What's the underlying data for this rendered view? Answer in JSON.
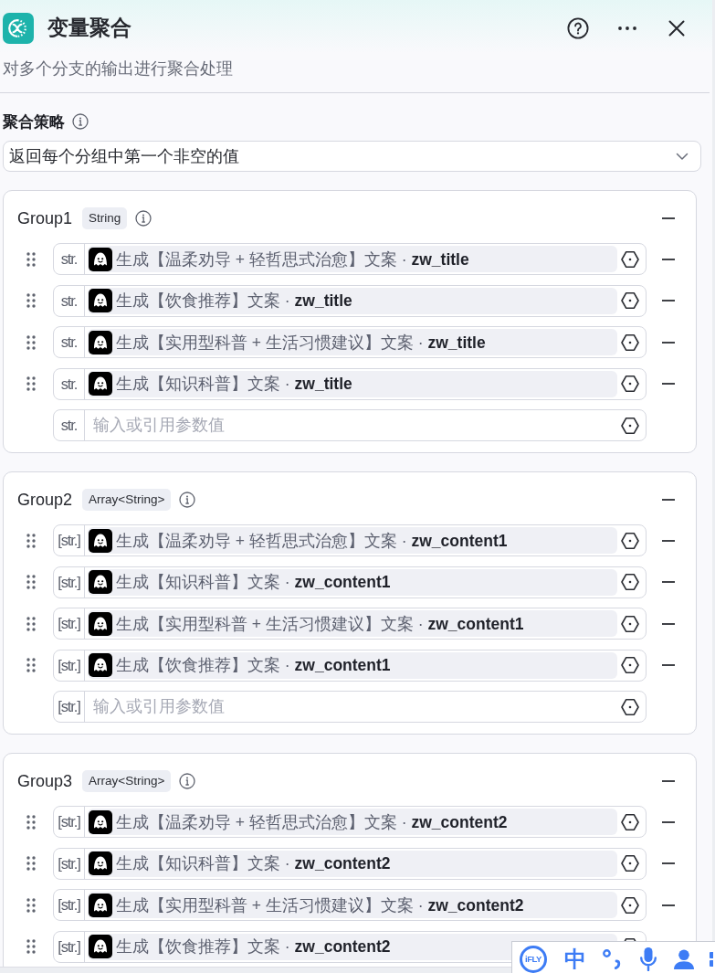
{
  "header": {
    "title": "变量聚合",
    "subtitle": "对多个分支的输出进行聚合处理"
  },
  "strategy": {
    "label": "聚合策略",
    "value": "返回每个分组中第一个非空的值"
  },
  "groups": [
    {
      "title": "Group1",
      "type": "String",
      "rows": [
        {
          "kind": "reference",
          "type_label": "str.",
          "text": "生成【温柔劝导 + 轻哲思式治愈】文案 · **zw_title**"
        },
        {
          "kind": "reference",
          "type_label": "str.",
          "text": "生成【饮食推荐】文案 · **zw_title**"
        },
        {
          "kind": "reference",
          "type_label": "str.",
          "text": "生成【实用型科普 + 生活习惯建议】文案 · **zw_title**"
        },
        {
          "kind": "reference",
          "type_label": "str.",
          "text": "生成【知识科普】文案 · **zw_title**"
        },
        {
          "kind": "input",
          "type_label": "str.",
          "placeholder": "输入或引用参数值"
        }
      ]
    },
    {
      "title": "Group2",
      "type": "Array<String>",
      "rows": [
        {
          "kind": "reference",
          "type_label": "[str.]",
          "text": "生成【温柔劝导 + 轻哲思式治愈】文案 · **zw_content1**"
        },
        {
          "kind": "reference",
          "type_label": "[str.]",
          "text": "生成【知识科普】文案 · **zw_content1**"
        },
        {
          "kind": "reference",
          "type_label": "[str.]",
          "text": "生成【实用型科普 + 生活习惯建议】文案 · **zw_content1**"
        },
        {
          "kind": "reference",
          "type_label": "[str.]",
          "text": "生成【饮食推荐】文案 · **zw_content1**"
        },
        {
          "kind": "input",
          "type_label": "[str.]",
          "placeholder": "输入或引用参数值"
        }
      ]
    },
    {
      "title": "Group3",
      "type": "Array<String>",
      "rows": [
        {
          "kind": "reference",
          "type_label": "[str.]",
          "text": "生成【温柔劝导 + 轻哲思式治愈】文案 · **zw_content2**"
        },
        {
          "kind": "reference",
          "type_label": "[str.]",
          "text": "生成【知识科普】文案 · **zw_content2**"
        },
        {
          "kind": "reference",
          "type_label": "[str.]",
          "text": "生成【实用型科普 + 生活习惯建议】文案 · **zw_content2**"
        },
        {
          "kind": "reference",
          "type_label": "[str.]",
          "text": "生成【饮食推荐】文案 · **zw_content2**"
        }
      ]
    }
  ],
  "ime_toolbar": {
    "logo": "iFLY",
    "mode": "中"
  }
}
